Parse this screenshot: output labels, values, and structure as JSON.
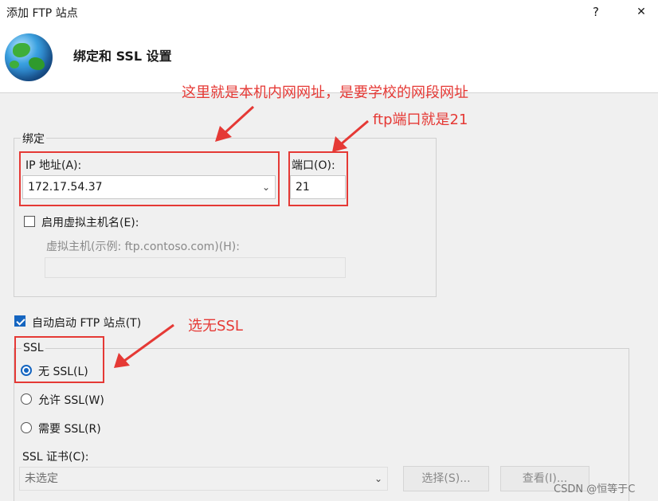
{
  "window": {
    "title": "添加 FTP 站点",
    "help": "?",
    "close": "✕"
  },
  "header": {
    "title": "绑定和 SSL 设置"
  },
  "binding": {
    "group_label": "绑定",
    "ip_label": "IP 地址(A):",
    "ip_value": "172.17.54.37",
    "port_label": "端口(O):",
    "port_value": "21",
    "virtual_host_checkbox": "启用虚拟主机名(E):",
    "virtual_host_label": "虚拟主机(示例: ftp.contoso.com)(H):",
    "virtual_host_value": ""
  },
  "autostart": {
    "label": "自动启动 FTP 站点(T)",
    "checked": true
  },
  "ssl": {
    "group_label": "SSL",
    "options": [
      {
        "label": "无 SSL(L)",
        "selected": true
      },
      {
        "label": "允许 SSL(W)",
        "selected": false
      },
      {
        "label": "需要 SSL(R)",
        "selected": false
      }
    ],
    "cert_label": "SSL 证书(C):",
    "cert_value": "未选定",
    "select_button": "选择(S)...",
    "view_button": "查看(I)..."
  },
  "annotations": {
    "ip_note": "这里就是本机内网网址，是要学校的网段网址",
    "port_note": "ftp端口就是21",
    "ssl_note": "选无SSL"
  },
  "watermark": "CSDN @恒等于C",
  "colors": {
    "annotation_red": "#e53935",
    "accent_blue": "#1565c0"
  }
}
